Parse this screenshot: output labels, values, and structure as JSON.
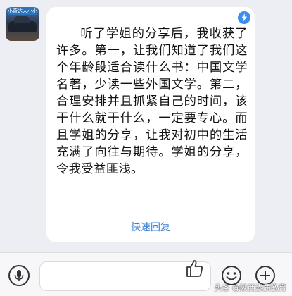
{
  "avatar": {
    "label": "小荷达人小小"
  },
  "message": {
    "text": "听了学姐的分享后，我收获了许多。第一，让我们知道了我们这个年龄段适合读什么书：中国文学名著，少读一些外国文学。第二，合理安排并且抓紧自己的时间，该干什么就干什么，一定要专心。而且学姐的分享，让我对初中的生活充满了向往与期待。学姐的分享，令我受益匪浅。",
    "badge_icon": "lightning-icon",
    "quick_reply_label": "快速回复"
  },
  "input_bar": {
    "voice_icon": "microphone-icon",
    "input_value": "",
    "like_icon": "thumbs-up-icon",
    "emoji_icon": "smiley-icon",
    "plus_icon": "plus-icon"
  },
  "watermark": {
    "text": "头条 @陕西素质教育"
  },
  "colors": {
    "accent": "#3d7fd6",
    "badge": "#3b8ef0",
    "background": "#eceef3"
  }
}
